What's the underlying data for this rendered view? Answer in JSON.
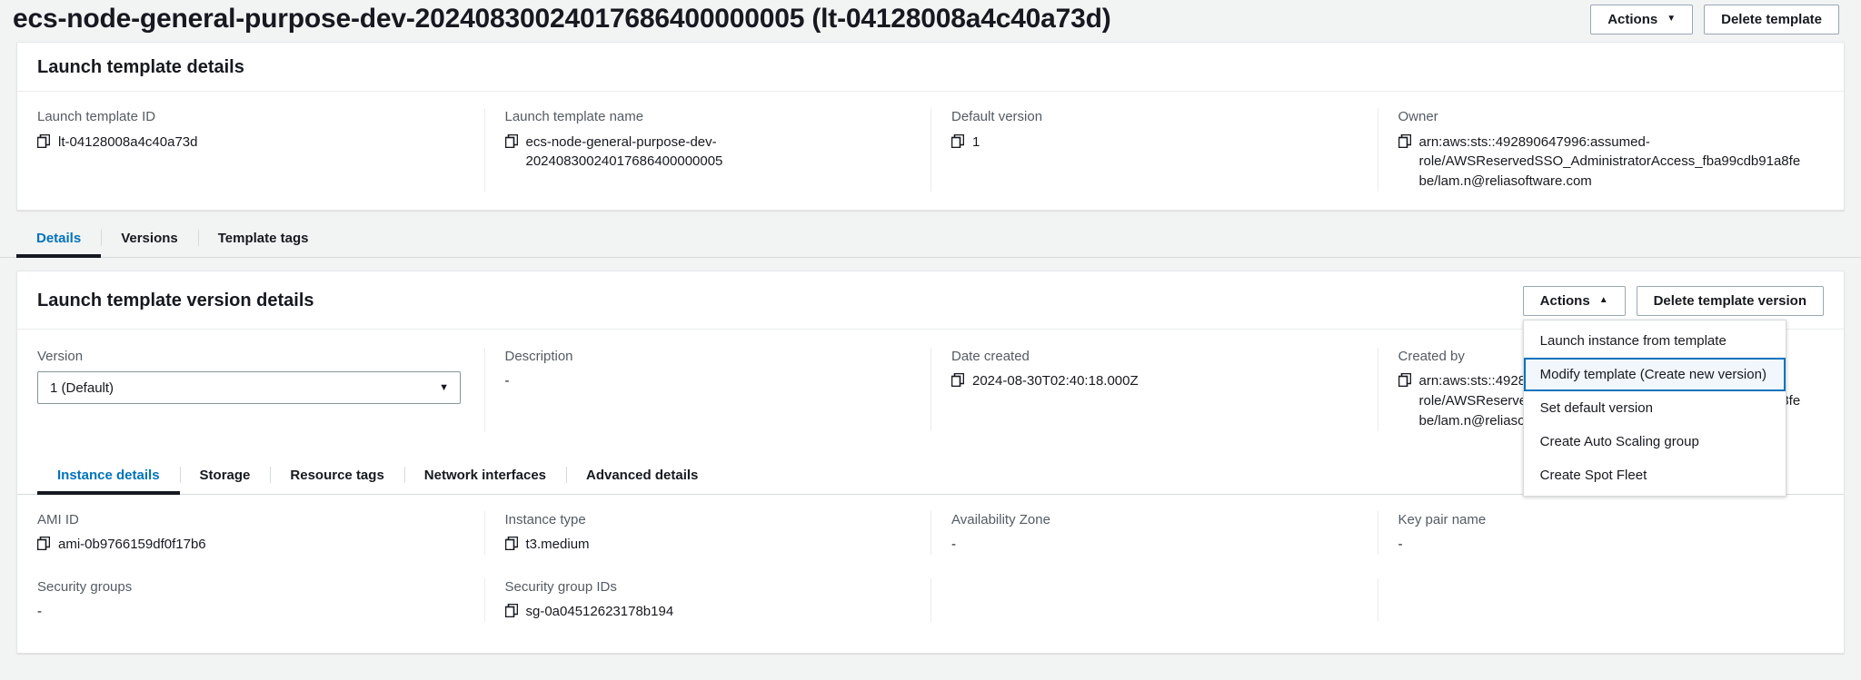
{
  "page": {
    "title": "ecs-node-general-purpose-dev-20240830024017686400000005 (lt-04128008a4c40a73d)"
  },
  "header_actions": {
    "actions_label": "Actions",
    "actions_caret": "▼",
    "delete_label": "Delete template"
  },
  "template_details": {
    "title": "Launch template details",
    "fields": [
      {
        "label": "Launch template ID",
        "value": "lt-04128008a4c40a73d",
        "copyable": true
      },
      {
        "label": "Launch template name",
        "value": "ecs-node-general-purpose-dev-20240830024017686400000005",
        "copyable": true
      },
      {
        "label": "Default version",
        "value": "1",
        "copyable": true
      },
      {
        "label": "Owner",
        "value": "arn:aws:sts::492890647996:assumed-role/AWSReservedSSO_AdministratorAccess_fba99cdb91a8febe/lam.n@reliasoftware.com",
        "copyable": true
      }
    ]
  },
  "main_tabs": [
    {
      "label": "Details",
      "active": true
    },
    {
      "label": "Versions",
      "active": false
    },
    {
      "label": "Template tags",
      "active": false
    }
  ],
  "version_details": {
    "title": "Launch template version details",
    "actions_label": "Actions",
    "actions_caret": "▲",
    "delete_label": "Delete template version",
    "menu_items": [
      {
        "label": "Launch instance from template",
        "highlighted": false
      },
      {
        "label": "Modify template (Create new version)",
        "highlighted": true
      },
      {
        "label": "Set default version",
        "highlighted": false
      },
      {
        "label": "Create Auto Scaling group",
        "highlighted": false
      },
      {
        "label": "Create Spot Fleet",
        "highlighted": false
      }
    ],
    "version_label": "Version",
    "version_value": "1 (Default)",
    "version_caret": "▼",
    "description_label": "Description",
    "description_value": "-",
    "date_created_label": "Date created",
    "date_created_value": "2024-08-30T02:40:18.000Z",
    "created_by_label": "Created by",
    "created_by_value": "arn:aws:sts::492890647996:assumed-role/AWSReservedSSO_AdministratorAccess_fba99cdb91a8febe/lam.n@reliasoftware.com"
  },
  "instance_tabs": [
    {
      "label": "Instance details",
      "active": true
    },
    {
      "label": "Storage",
      "active": false
    },
    {
      "label": "Resource tags",
      "active": false
    },
    {
      "label": "Network interfaces",
      "active": false
    },
    {
      "label": "Advanced details",
      "active": false
    }
  ],
  "instance_details": {
    "row1": [
      {
        "label": "AMI ID",
        "value": "ami-0b9766159df0f17b6",
        "copyable": true
      },
      {
        "label": "Instance type",
        "value": "t3.medium",
        "copyable": true
      },
      {
        "label": "Availability Zone",
        "value": "-",
        "copyable": false
      },
      {
        "label": "Key pair name",
        "value": "-",
        "copyable": false
      }
    ],
    "row2": [
      {
        "label": "Security groups",
        "value": "-",
        "copyable": false
      },
      {
        "label": "Security group IDs",
        "value": "sg-0a04512623178b194",
        "copyable": true
      },
      {
        "label": "",
        "value": "",
        "copyable": false
      },
      {
        "label": "",
        "value": "",
        "copyable": false
      }
    ]
  },
  "colors": {
    "page_bg": "#f2f3f3",
    "accent_link": "#0073bb",
    "text_primary": "#16191f",
    "text_secondary": "#545b64",
    "border": "#d5dbdb"
  }
}
